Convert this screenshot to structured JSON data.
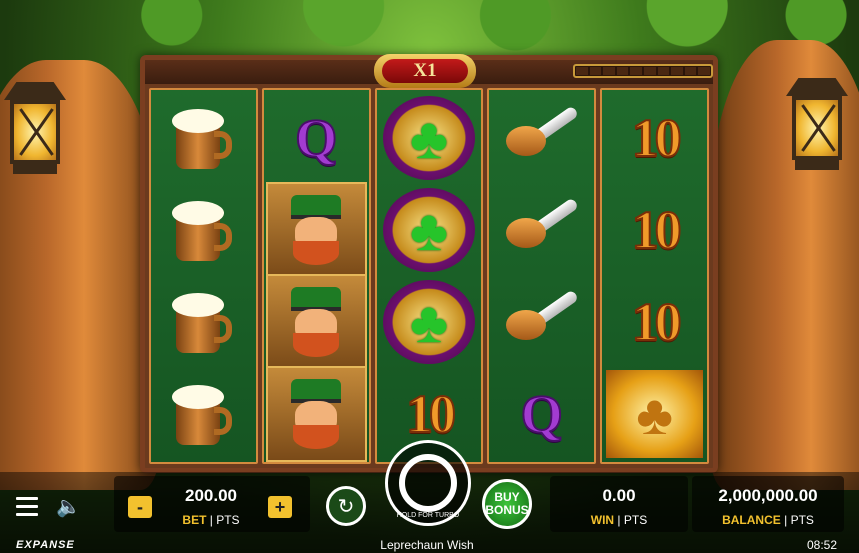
{
  "game": {
    "title": "Leprechaun Wish",
    "multiplier": "X1",
    "clock": "08:52",
    "provider_logo": "EXPANSE"
  },
  "reels": [
    [
      "beer-mug",
      "beer-mug",
      "beer-mug",
      "beer-mug"
    ],
    [
      "Q",
      "leprechaun",
      "leprechaun",
      "leprechaun"
    ],
    [
      "clover",
      "clover",
      "clover",
      "10"
    ],
    [
      "pipe",
      "pipe",
      "pipe",
      "Q"
    ],
    [
      "10",
      "10",
      "10",
      "gold-coin"
    ]
  ],
  "controls": {
    "bet_value": "200.00",
    "bet_label": "BET",
    "bet_unit": "PTS",
    "minus": "-",
    "plus": "+",
    "autoplay_icon": "↻",
    "spin_hint": "HOLD FOR TURBO",
    "buy_bonus": "BUY BONUS",
    "win_value": "0.00",
    "win_label": "WIN",
    "win_unit": "PTS",
    "balance_value": "2,000,000.00",
    "balance_label": "BALANCE",
    "balance_unit": "PTS",
    "speaker_icon": "🔈"
  }
}
